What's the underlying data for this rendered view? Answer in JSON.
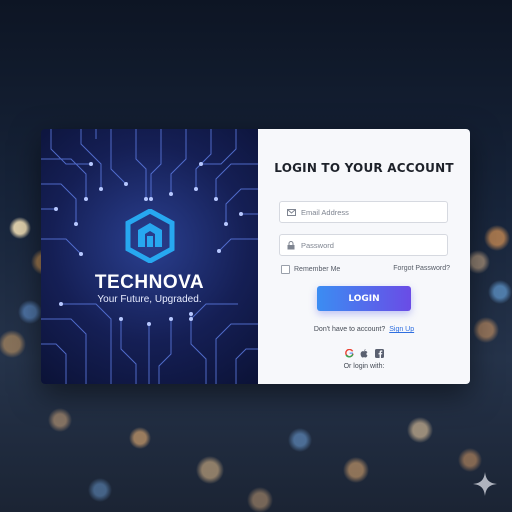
{
  "brand": {
    "name": "TECHNOVA",
    "tagline": "Your Future, Upgraded."
  },
  "form": {
    "title": "LOGIN TO YOUR ACCOUNT",
    "email_placeholder": "Email Address",
    "password_placeholder": "Password",
    "remember_label": "Remember Me",
    "forgot_label": "Forgot Password?",
    "login_label": "LOGIN",
    "signup_prompt": "Don't have to account?",
    "signup_link": "Sign Up",
    "social_icons": [
      "google-icon",
      "apple-icon",
      "facebook-icon"
    ],
    "social_label": "Or login with:"
  },
  "colors": {
    "accent_start": "#3b8df2",
    "accent_end": "#6a4ce6",
    "link": "#2f6fe0",
    "logo": "#27a8f0"
  }
}
